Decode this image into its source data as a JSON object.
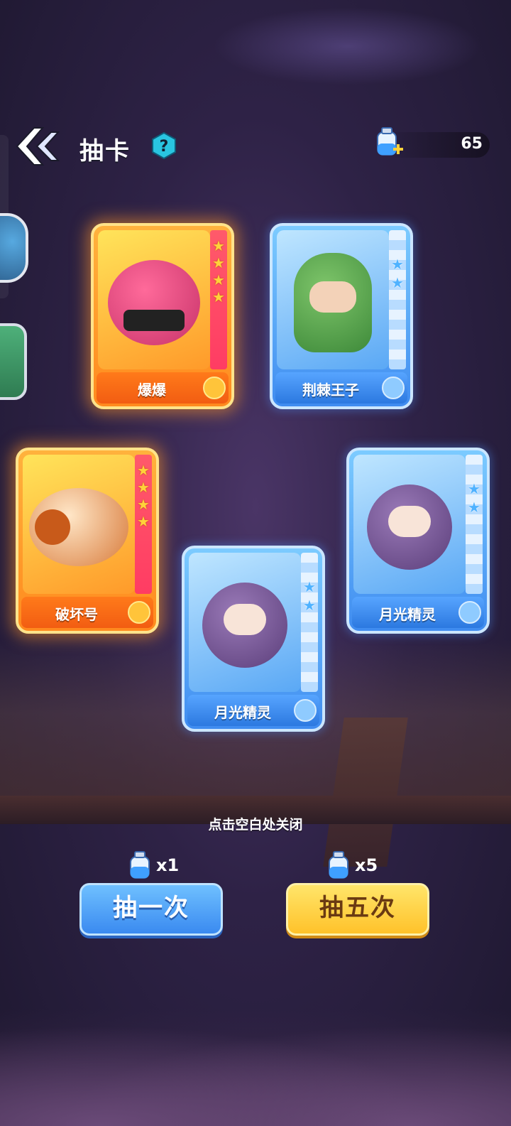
{
  "header": {
    "title": "抽卡",
    "help_icon": "question-mark-icon",
    "back_icon": "double-chevron-left-icon"
  },
  "currency": {
    "icon": "potion-bottle-plus-icon",
    "value": "65"
  },
  "cards": [
    {
      "name": "爆爆",
      "rarity": "gold",
      "stars": 4
    },
    {
      "name": "荆棘王子",
      "rarity": "blue",
      "stars": 2
    },
    {
      "name": "破坏号",
      "rarity": "gold",
      "stars": 4
    },
    {
      "name": "月光精灵",
      "rarity": "blue",
      "stars": 2
    },
    {
      "name": "月光精灵",
      "rarity": "blue",
      "stars": 2
    }
  ],
  "close_hint": "点击空白处关闭",
  "draw_once": {
    "cost": "x1",
    "label": "抽一次"
  },
  "draw_five": {
    "cost": "x5",
    "label": "抽五次"
  },
  "colors": {
    "gold_card": "#ff9a2a",
    "blue_card": "#4f96f0",
    "button_blue": "#3a8af0",
    "button_yellow": "#ffc22a"
  }
}
